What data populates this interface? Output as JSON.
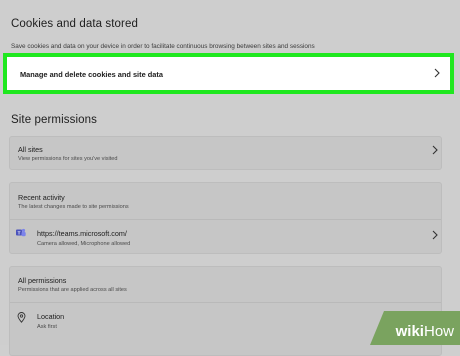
{
  "cookies": {
    "title": "Cookies and data stored",
    "description": "Save cookies and data on your device in order to facilitate continuous browsing between sites and sessions",
    "manage_label": "Manage and delete cookies and site data"
  },
  "site_permissions": {
    "title": "Site permissions",
    "all_sites": {
      "label": "All sites",
      "sub": "View permissions for sites you've visited"
    },
    "recent_activity": {
      "label": "Recent activity",
      "sub": "The latest changes made to site permissions",
      "entries": [
        {
          "site": "https://teams.microsoft.com/",
          "detail": "Camera allowed, Microphone allowed",
          "icon": "teams-icon"
        }
      ]
    },
    "all_permissions": {
      "label": "All permissions",
      "sub": "Permissions that are applied across all sites",
      "items": [
        {
          "label": "Location",
          "sub": "Ask first",
          "icon": "location-icon"
        }
      ]
    }
  },
  "watermark": {
    "text_bold": "wiki",
    "text_rest": "How"
  },
  "colors": {
    "highlight": "#1fe81f",
    "background": "#cecece",
    "card": "#c6c6c6",
    "watermark": "#7aa35f"
  }
}
